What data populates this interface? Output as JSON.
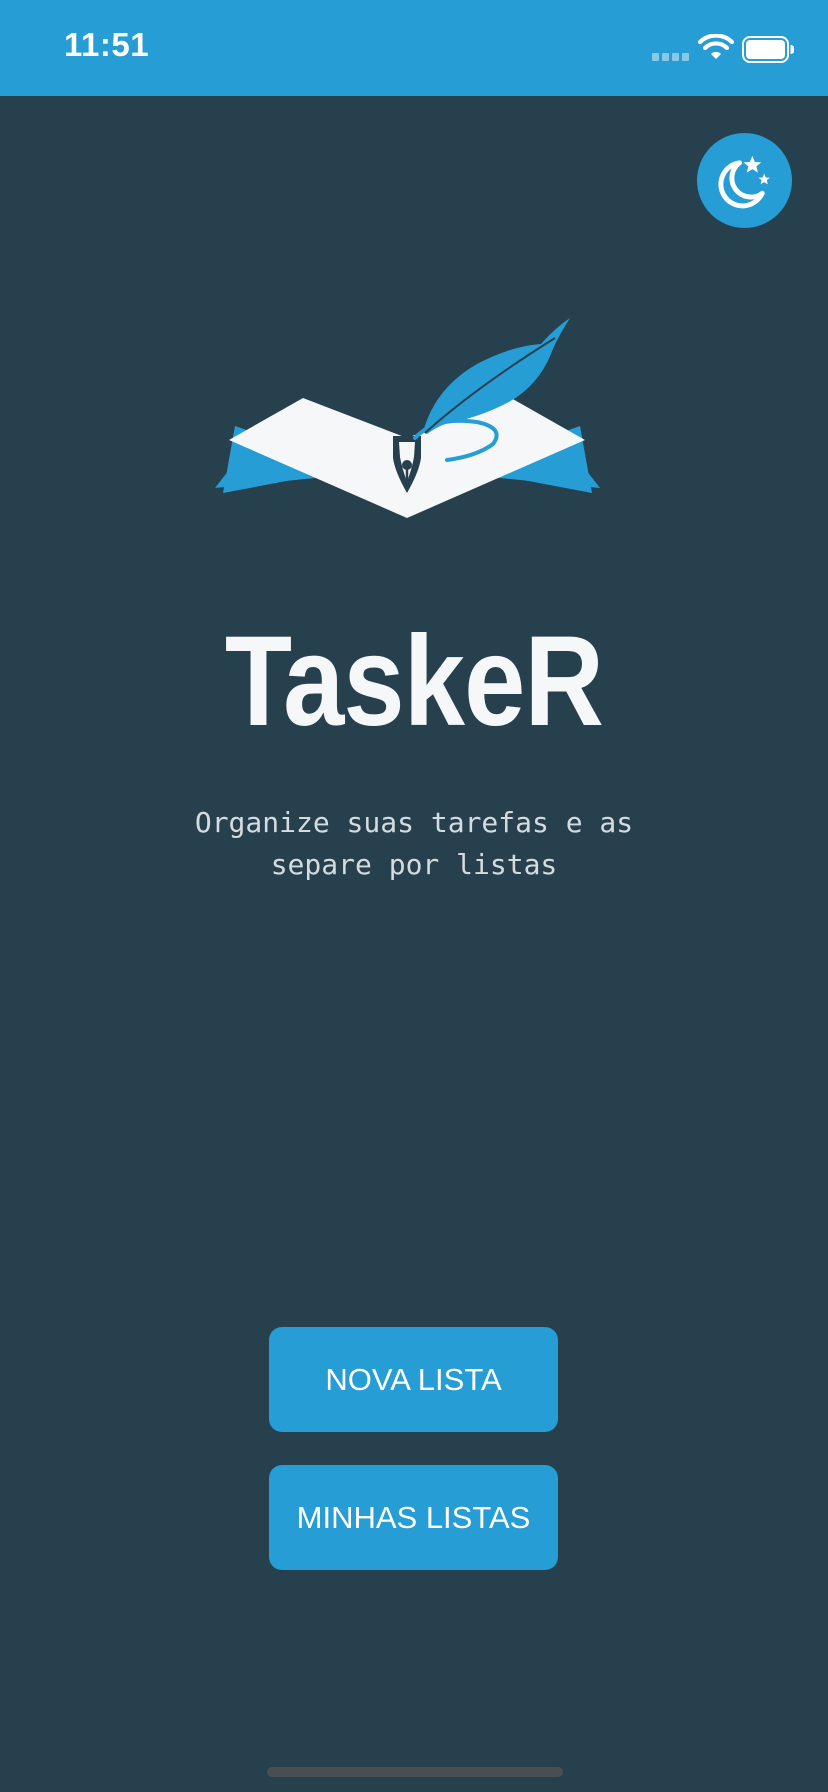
{
  "status_bar": {
    "time": "11:51",
    "icons": [
      "signal-icon",
      "wifi-icon",
      "battery-icon"
    ]
  },
  "theme_toggle": {
    "icon": "moon-stars-icon"
  },
  "logo": {
    "icon": "open-book-quill-icon"
  },
  "app": {
    "title": "TaskeR",
    "subtitle_line1": "Organize suas tarefas e as",
    "subtitle_line2": "separe por listas"
  },
  "actions": {
    "new_list_label": "NOVA LISTA",
    "my_lists_label": "MINHAS LISTAS"
  },
  "colors": {
    "background": "#27404e",
    "accent": "#279dd5",
    "text_primary": "#f6f7f9",
    "text_secondary": "#d5dbdf"
  }
}
